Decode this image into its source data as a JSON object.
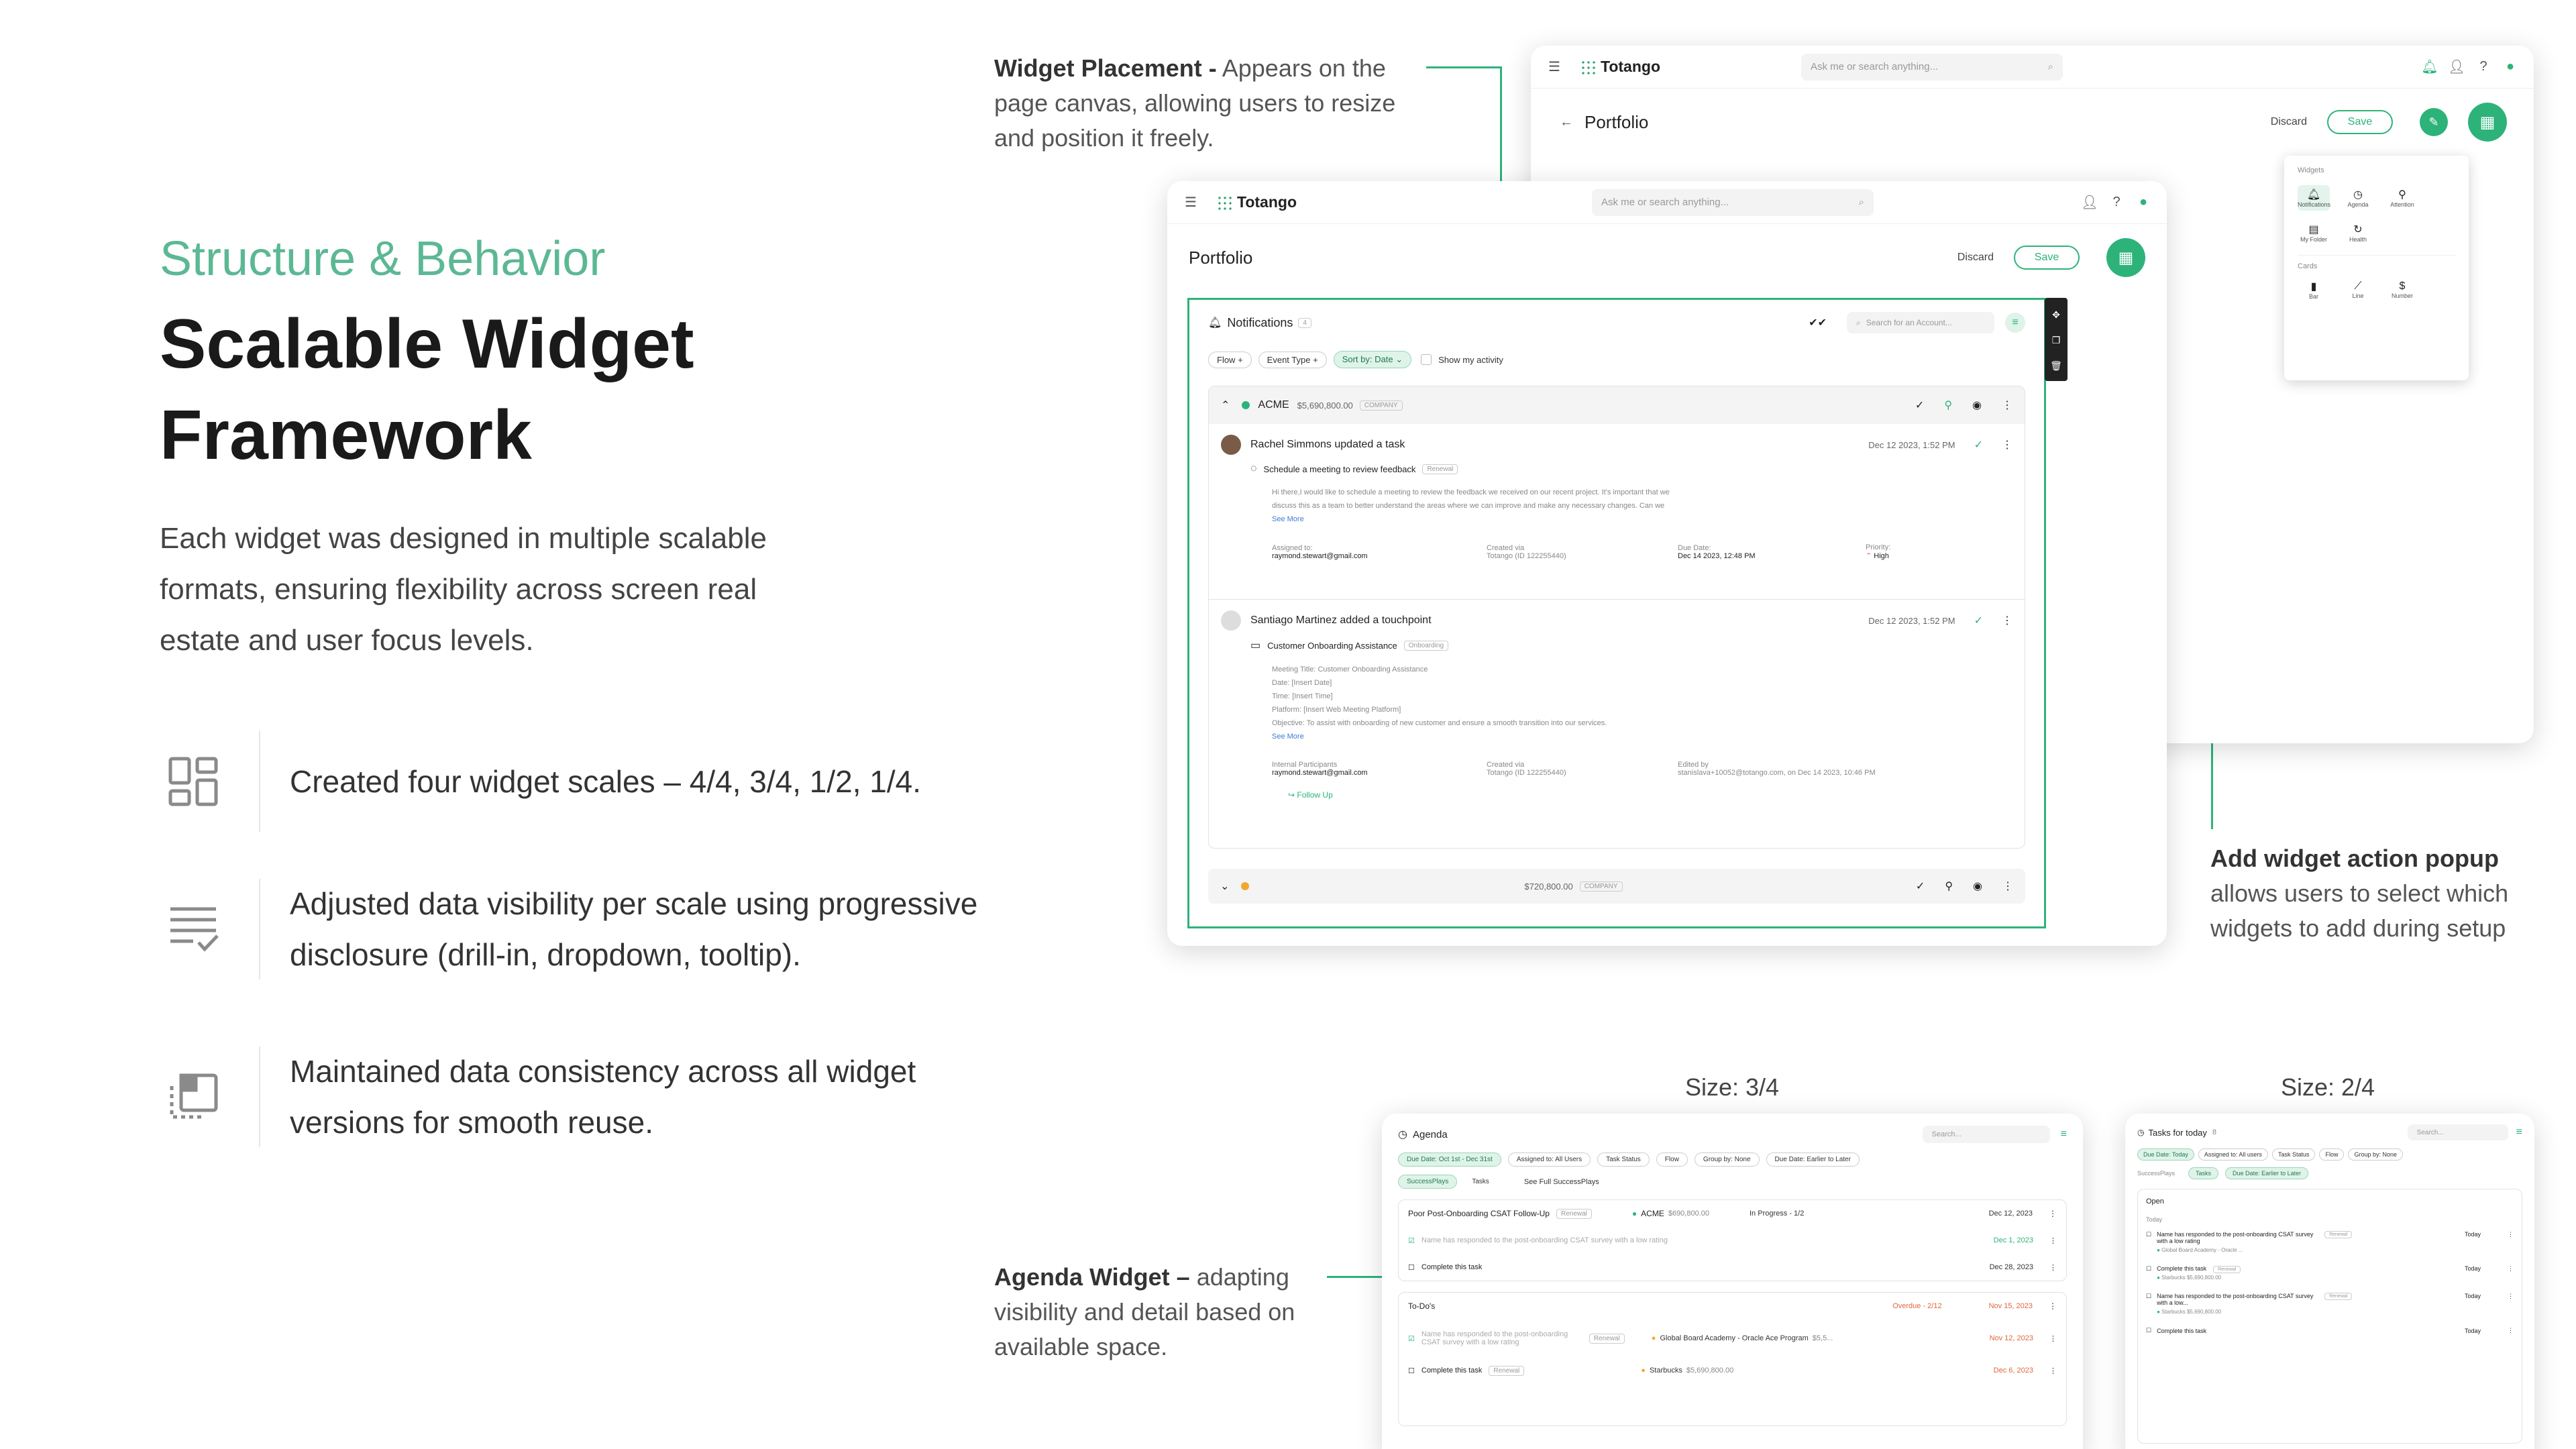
{
  "hero": {
    "eyebrow": "Structure & Behavior",
    "title_line1": "Scalable Widget",
    "title_line2": "Framework",
    "intro": "Each widget was designed in multiple scalable formats, ensuring flexibility across screen real estate and user focus levels."
  },
  "features": [
    {
      "icon": "widget-grid-icon",
      "text": "Created four widget scales – 4/4, 3/4, 1/2, 1/4."
    },
    {
      "icon": "list-check-icon",
      "text": "Adjusted data visibility per scale using progressive disclosure (drill-in, dropdown, tooltip)."
    },
    {
      "icon": "window-copy-icon",
      "text": "Maintained data consistency across all widget versions for smooth reuse."
    }
  ],
  "annotations": {
    "placement_title": "Widget Placement -",
    "placement_body": "Appears on the page canvas, allowing users to resize and position it freely.",
    "popup_title": "Add widget action popup",
    "popup_body": "allows users to select which widgets to add during setup",
    "agenda_title": "Agenda Widget –",
    "agenda_body": "adapting visibility and detail based on available space.",
    "size_34": "Size: 3/4",
    "size_24": "Size: 2/4"
  },
  "app": {
    "logo": "Totango",
    "search_placeholder": "Ask me or search anything...",
    "page_title": "Portfolio",
    "discard": "Discard",
    "save": "Save",
    "notif_count": "4"
  },
  "popup": {
    "section_widgets": "Widgets",
    "widgets": [
      "Notifications",
      "Agenda",
      "Attention",
      "My Folder",
      "Health"
    ],
    "section_cards": "Cards",
    "cards": [
      "Bar",
      "Line",
      "Number"
    ]
  },
  "notifications": {
    "title": "Notifications",
    "count": "4",
    "search_placeholder": "Search for an Account...",
    "filters": [
      "Flow",
      "Event Type",
      "Sort by: Date"
    ],
    "show_my_activity": "Show my activity",
    "group1": {
      "name": "ACME",
      "amount": "$5,690,800.00",
      "tag": "COMPANY"
    },
    "item1": {
      "title": "Rachel Simmons updated a task",
      "date": "Dec 12 2023, 1:52 PM",
      "task": "Schedule a meeting to review feedback",
      "task_tag": "Renewal",
      "body1": "Hi there,I would like to schedule a meeting to review the feedback we received on our recent project. It's important that we",
      "body2": "discuss this as a team to better understand the areas where we can improve and make any necessary changes. Can we",
      "see_more": "See More",
      "l_assigned": "Assigned to:",
      "v_assigned": "raymond.stewart@gmail.com",
      "l_created": "Created via",
      "v_created": "Totango (ID 122255440)",
      "l_due": "Due Date:",
      "v_due": "Dec 14 2023, 12:48 PM",
      "l_priority": "Priority:",
      "v_priority": "High"
    },
    "item2": {
      "title": "Santiago Martinez added a touchpoint",
      "date": "Dec 12 2023, 1:52 PM",
      "task": "Customer Onboarding Assistance",
      "task_tag": "Onboarding",
      "lines": [
        "Meeting Title: Customer Onboarding Assistance",
        "Date: [Insert Date]",
        "Time: [Insert Time]",
        "Platform: [Insert Web Meeting Platform]",
        "Objective: To assist with onboarding of new customer and ensure a smooth transition into our services."
      ],
      "see_more": "See More",
      "l_internal": "Internal Participants",
      "v_internal": "raymond.stewart@gmail.com",
      "l_created": "Created via",
      "v_created": "Totango (ID 122255440)",
      "l_edited": "Edited by",
      "v_edited": "stanislava+10052@totango.com, on Dec 14 2023, 10:46 PM",
      "follow_up": "Follow Up"
    },
    "group2": {
      "amount": "$720,800.00",
      "tag": "COMPANY"
    }
  },
  "agenda": {
    "title": "Agenda",
    "search_placeholder": "Search...",
    "filters": [
      "Due Date: Oct 1st - Dec 31st",
      "Assigned to: All Users",
      "Task Status",
      "Flow",
      "Group by: None",
      "Due Date: Earlier to Later"
    ],
    "tabs": [
      "SuccessPlays",
      "Tasks"
    ],
    "see_full": "See Full SuccessPlays",
    "group1": {
      "title": "Poor Post-Onboarding CSAT Follow-Up",
      "tag": "Renewal",
      "account": "ACME",
      "amount": "$690,800.00",
      "status": "In Progress - 1/2",
      "date": "Dec 12, 2023"
    },
    "g1_rows": [
      {
        "text": "Name has responded to the post-onboarding CSAT survey with a low rating",
        "date": "Dec 1, 2023"
      },
      {
        "text": "Complete this task",
        "date": "Dec 28, 2023"
      }
    ],
    "group2": {
      "title": "To-Do's",
      "status": "Overdue - 2/12",
      "date": "Nov 15, 2023"
    },
    "g2_rows": [
      {
        "text": "Name has responded to the post-onboarding CSAT survey with a low rating",
        "tag": "Renewal",
        "account": "Global Board Academy - Oracle Ace Program",
        "amount": "$5,5...",
        "date": "Nov 12, 2023"
      },
      {
        "text": "Complete this task",
        "tag": "Renewal",
        "account": "Starbucks",
        "amount": "$5,690,800.00",
        "date": "Dec 6, 2023"
      }
    ]
  },
  "tasks": {
    "title": "Tasks for today",
    "count": "8",
    "search_placeholder": "Search...",
    "filters": [
      "Due Date: Today",
      "Assigned to: All users",
      "Task Status",
      "Flow",
      "Group by: None"
    ],
    "tabs": [
      "SuccessPlays",
      "Tasks",
      "Due Date: Earlier to Later"
    ],
    "open": "Open",
    "today": "Today",
    "rows": [
      {
        "text": "Name has responded to the post-onboarding CSAT survey with a low rating",
        "tag": "Renewal",
        "account": "Global Board Academy - Oracle ...",
        "due": "Today"
      },
      {
        "text": "Complete this task",
        "tag": "Renewal",
        "account": "Starbucks",
        "amount": "$5,690,800.00",
        "due": "Today"
      },
      {
        "text": "Name has responded to the post-onboarding CSAT survey with a low...",
        "tag": "Renewal",
        "account": "Starbucks",
        "amount": "$5,690,800.00",
        "due": "Today"
      },
      {
        "text": "Complete this task",
        "due": "Today"
      }
    ]
  },
  "colors": {
    "accent": "#2db37a",
    "eyebrow": "#5cb894"
  }
}
